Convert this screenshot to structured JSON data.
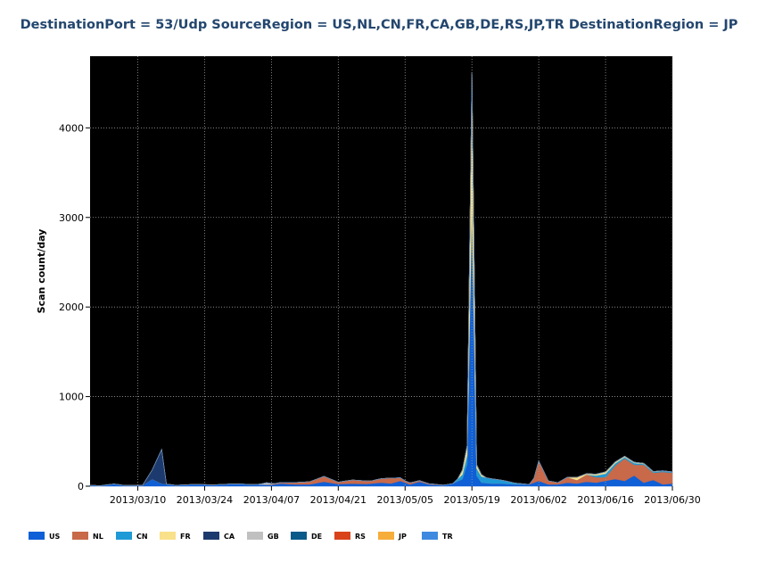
{
  "chart_data": {
    "type": "area",
    "title": "DestinationPort = 53/Udp SourceRegion = US,NL,CN,FR,CA,GB,DE,RS,JP,TR DestinationRegion = JP",
    "xlabel": "",
    "ylabel": "Scan count/day",
    "xlim": [
      "2013/02/28",
      "2013/06/30"
    ],
    "ylim": [
      0,
      4800
    ],
    "yticks": [
      0,
      1000,
      2000,
      3000,
      4000
    ],
    "xticks": [
      "2013/03/10",
      "2013/03/24",
      "2013/04/07",
      "2013/04/21",
      "2013/05/05",
      "2013/05/19",
      "2013/06/02",
      "2013/06/16",
      "2013/06/30"
    ],
    "grid": true,
    "stacked": true,
    "legend_position": "bottom",
    "background": "#000000",
    "series": [
      {
        "name": "US",
        "color": "#0f5fd6",
        "points": [
          [
            "2013/02/28",
            10
          ],
          [
            "2013/03/02",
            5
          ],
          [
            "2013/03/05",
            25
          ],
          [
            "2013/03/07",
            10
          ],
          [
            "2013/03/11",
            10
          ],
          [
            "2013/03/13",
            80
          ],
          [
            "2013/03/15",
            30
          ],
          [
            "2013/03/18",
            10
          ],
          [
            "2013/03/22",
            20
          ],
          [
            "2013/03/26",
            15
          ],
          [
            "2013/03/30",
            25
          ],
          [
            "2013/04/03",
            20
          ],
          [
            "2013/04/07",
            15
          ],
          [
            "2013/04/09",
            30
          ],
          [
            "2013/04/12",
            20
          ],
          [
            "2013/04/15",
            20
          ],
          [
            "2013/04/18",
            50
          ],
          [
            "2013/04/21",
            25
          ],
          [
            "2013/04/24",
            30
          ],
          [
            "2013/04/27",
            25
          ],
          [
            "2013/04/30",
            40
          ],
          [
            "2013/05/02",
            30
          ],
          [
            "2013/05/04",
            60
          ],
          [
            "2013/05/06",
            20
          ],
          [
            "2013/05/08",
            50
          ],
          [
            "2013/05/10",
            20
          ],
          [
            "2013/05/13",
            10
          ],
          [
            "2013/05/15",
            30
          ],
          [
            "2013/05/17",
            80
          ],
          [
            "2013/05/18",
            250
          ],
          [
            "2013/05/19",
            3100
          ],
          [
            "2013/05/20",
            120
          ],
          [
            "2013/05/21",
            40
          ],
          [
            "2013/05/23",
            30
          ],
          [
            "2013/05/25",
            30
          ],
          [
            "2013/05/28",
            20
          ],
          [
            "2013/05/31",
            20
          ],
          [
            "2013/06/02",
            60
          ],
          [
            "2013/06/04",
            20
          ],
          [
            "2013/06/06",
            20
          ],
          [
            "2013/06/08",
            40
          ],
          [
            "2013/06/10",
            30
          ],
          [
            "2013/06/12",
            50
          ],
          [
            "2013/06/14",
            40
          ],
          [
            "2013/06/16",
            60
          ],
          [
            "2013/06/18",
            80
          ],
          [
            "2013/06/20",
            60
          ],
          [
            "2013/06/22",
            120
          ],
          [
            "2013/06/24",
            40
          ],
          [
            "2013/06/26",
            70
          ],
          [
            "2013/06/28",
            20
          ],
          [
            "2013/06/30",
            30
          ]
        ]
      },
      {
        "name": "NL",
        "color": "#c8694a",
        "points": [
          [
            "2013/02/28",
            0
          ],
          [
            "2013/04/05",
            0
          ],
          [
            "2013/04/15",
            30
          ],
          [
            "2013/04/18",
            60
          ],
          [
            "2013/04/21",
            20
          ],
          [
            "2013/04/24",
            40
          ],
          [
            "2013/04/28",
            30
          ],
          [
            "2013/05/02",
            60
          ],
          [
            "2013/05/05",
            20
          ],
          [
            "2013/05/09",
            10
          ],
          [
            "2013/05/14",
            0
          ],
          [
            "2013/05/31",
            0
          ],
          [
            "2013/06/01",
            50
          ],
          [
            "2013/06/02",
            220
          ],
          [
            "2013/06/04",
            40
          ],
          [
            "2013/06/06",
            20
          ],
          [
            "2013/06/08",
            60
          ],
          [
            "2013/06/10",
            40
          ],
          [
            "2013/06/12",
            80
          ],
          [
            "2013/06/14",
            60
          ],
          [
            "2013/06/16",
            40
          ],
          [
            "2013/06/18",
            150
          ],
          [
            "2013/06/20",
            250
          ],
          [
            "2013/06/22",
            120
          ],
          [
            "2013/06/24",
            200
          ],
          [
            "2013/06/26",
            80
          ],
          [
            "2013/06/28",
            140
          ],
          [
            "2013/06/30",
            120
          ]
        ]
      },
      {
        "name": "CN",
        "color": "#1e9ad6",
        "points": [
          [
            "2013/02/28",
            0
          ],
          [
            "2013/05/15",
            0
          ],
          [
            "2013/05/17",
            50
          ],
          [
            "2013/05/18",
            100
          ],
          [
            "2013/05/19",
            120
          ],
          [
            "2013/05/20",
            80
          ],
          [
            "2013/05/22",
            60
          ],
          [
            "2013/05/25",
            40
          ],
          [
            "2013/05/28",
            15
          ],
          [
            "2013/05/31",
            0
          ],
          [
            "2013/06/12",
            0
          ],
          [
            "2013/06/14",
            20
          ],
          [
            "2013/06/16",
            40
          ],
          [
            "2013/06/18",
            25
          ],
          [
            "2013/06/20",
            15
          ],
          [
            "2013/06/22",
            20
          ],
          [
            "2013/06/24",
            10
          ],
          [
            "2013/06/30",
            10
          ]
        ]
      },
      {
        "name": "FR",
        "color": "#f9e08a",
        "points": [
          [
            "2013/02/28",
            0
          ],
          [
            "2013/05/16",
            0
          ],
          [
            "2013/05/18",
            100
          ],
          [
            "2013/05/19",
            1400
          ],
          [
            "2013/05/20",
            40
          ],
          [
            "2013/05/22",
            0
          ],
          [
            "2013/06/08",
            0
          ],
          [
            "2013/06/10",
            30
          ],
          [
            "2013/06/12",
            10
          ],
          [
            "2013/06/16",
            20
          ],
          [
            "2013/06/20",
            10
          ],
          [
            "2013/06/30",
            0
          ]
        ]
      },
      {
        "name": "CA",
        "color": "#1d3a6e",
        "points": [
          [
            "2013/02/28",
            0
          ],
          [
            "2013/03/11",
            0
          ],
          [
            "2013/03/13",
            100
          ],
          [
            "2013/03/15",
            380
          ],
          [
            "2013/03/16",
            0
          ],
          [
            "2013/06/30",
            0
          ]
        ]
      },
      {
        "name": "GB",
        "color": "#c0c0c0",
        "points": [
          [
            "2013/02/28",
            0
          ],
          [
            "2013/04/04",
            0
          ],
          [
            "2013/04/06",
            20
          ],
          [
            "2013/04/08",
            0
          ],
          [
            "2013/06/30",
            0
          ]
        ]
      },
      {
        "name": "DE",
        "color": "#0a5a8a",
        "points": [
          [
            "2013/02/28",
            0
          ],
          [
            "2013/06/30",
            0
          ]
        ]
      },
      {
        "name": "RS",
        "color": "#d9431a",
        "points": [
          [
            "2013/02/28",
            0
          ],
          [
            "2013/06/30",
            0
          ]
        ]
      },
      {
        "name": "JP",
        "color": "#f6ad3a",
        "points": [
          [
            "2013/02/28",
            0
          ],
          [
            "2013/06/30",
            0
          ]
        ]
      },
      {
        "name": "TR",
        "color": "#3d8ae0",
        "points": [
          [
            "2013/02/28",
            0
          ],
          [
            "2013/06/30",
            0
          ]
        ]
      }
    ]
  }
}
